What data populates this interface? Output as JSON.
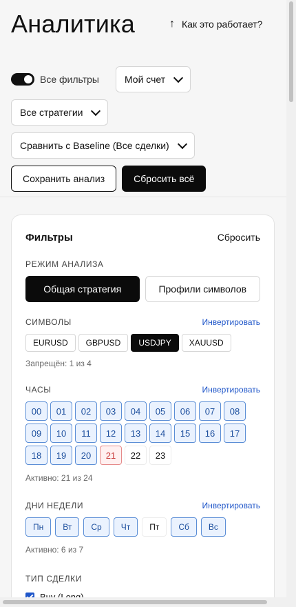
{
  "header": {
    "title": "Аналитика",
    "how_link": "Как это работает?"
  },
  "controls": {
    "all_filters_label": "Все фильтры",
    "account_dropdown": "Мой счет",
    "strategies_dropdown": "Все стратегии",
    "compare_dropdown": "Сравнить с Baseline (Все сделки)",
    "save_button": "Сохранить анализ",
    "reset_all_button": "Сбросить всё"
  },
  "filters": {
    "title": "Фильтры",
    "reset": "Сбросить",
    "mode": {
      "label": "РЕЖИМ АНАЛИЗА",
      "options": [
        "Общая стратегия",
        "Профили символов"
      ]
    },
    "symbols": {
      "label": "СИМВОЛЫ",
      "invert": "Инвертировать",
      "items": [
        "EURUSD",
        "GBPUSD",
        "USDJPY",
        "XAUUSD"
      ],
      "note": "Запрещён: 1 из 4"
    },
    "hours": {
      "label": "ЧАСЫ",
      "invert": "Инвертировать",
      "items": [
        "00",
        "01",
        "02",
        "03",
        "04",
        "05",
        "06",
        "07",
        "08",
        "09",
        "10",
        "11",
        "12",
        "13",
        "14",
        "15",
        "16",
        "17",
        "18",
        "19",
        "20",
        "21",
        "22",
        "23"
      ],
      "note": "Активно: 21 из 24"
    },
    "days": {
      "label": "ДНИ НЕДЕЛИ",
      "invert": "Инвертировать",
      "items": [
        "Пн",
        "Вт",
        "Ср",
        "Чт",
        "Пт",
        "Сб",
        "Вс"
      ],
      "note": "Активно: 6 из 7"
    },
    "trade_type": {
      "label": "ТИП СДЕЛКИ",
      "buy": "Buy (Long)"
    }
  }
}
